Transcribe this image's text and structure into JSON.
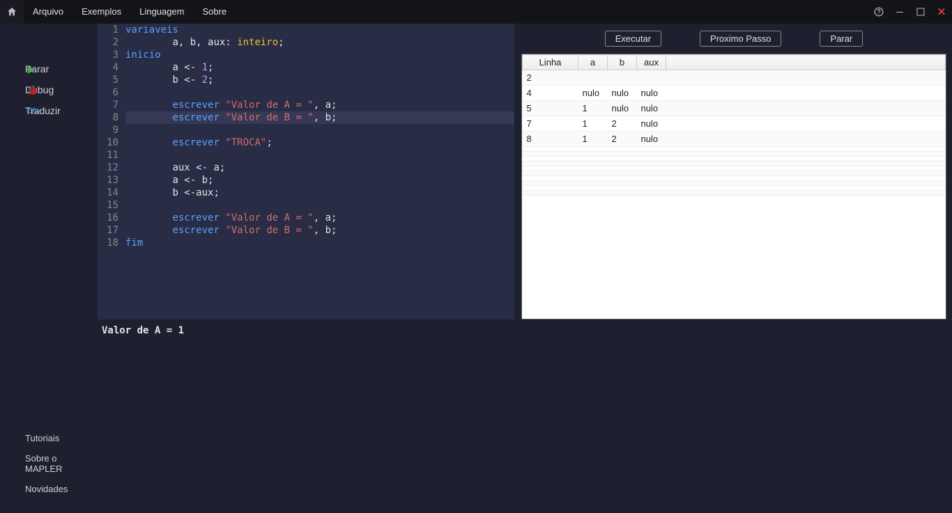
{
  "menu": {
    "items": [
      "Arquivo",
      "Exemplos",
      "Linguagem",
      "Sobre"
    ]
  },
  "sidebar": {
    "items": [
      {
        "icon": "play-icon",
        "label": "Parar"
      },
      {
        "icon": "bug-icon",
        "label": "Debug"
      },
      {
        "icon": "code-icon",
        "label": "Traduzir"
      }
    ],
    "bottom": [
      "Tutoriais",
      "Sobre o MAPLER",
      "Novidades"
    ]
  },
  "editor": {
    "highlight_line": 8,
    "lines": [
      {
        "n": 1,
        "tokens": [
          {
            "t": "variaveis",
            "c": "kw"
          }
        ]
      },
      {
        "n": 2,
        "tokens": [
          {
            "t": "        ",
            "c": ""
          },
          {
            "t": "a, b, aux",
            "c": "ident"
          },
          {
            "t": ": ",
            "c": "punct"
          },
          {
            "t": "inteiro",
            "c": "type"
          },
          {
            "t": ";",
            "c": "punct"
          }
        ]
      },
      {
        "n": 3,
        "tokens": [
          {
            "t": "inicio",
            "c": "kw"
          }
        ]
      },
      {
        "n": 4,
        "tokens": [
          {
            "t": "        ",
            "c": ""
          },
          {
            "t": "a ",
            "c": "ident"
          },
          {
            "t": "<- ",
            "c": "punct"
          },
          {
            "t": "1",
            "c": "num"
          },
          {
            "t": ";",
            "c": "punct"
          }
        ]
      },
      {
        "n": 5,
        "tokens": [
          {
            "t": "        ",
            "c": ""
          },
          {
            "t": "b ",
            "c": "ident"
          },
          {
            "t": "<- ",
            "c": "punct"
          },
          {
            "t": "2",
            "c": "num"
          },
          {
            "t": ";",
            "c": "punct"
          }
        ]
      },
      {
        "n": 6,
        "tokens": []
      },
      {
        "n": 7,
        "tokens": [
          {
            "t": "        ",
            "c": ""
          },
          {
            "t": "escrever",
            "c": "kw"
          },
          {
            "t": " ",
            "c": ""
          },
          {
            "t": "\"Valor de A = \"",
            "c": "str"
          },
          {
            "t": ", a;",
            "c": "ident"
          }
        ]
      },
      {
        "n": 8,
        "tokens": [
          {
            "t": "        ",
            "c": ""
          },
          {
            "t": "escrever",
            "c": "kw"
          },
          {
            "t": " ",
            "c": ""
          },
          {
            "t": "\"Valor de B = \"",
            "c": "str"
          },
          {
            "t": ", b;",
            "c": "ident"
          }
        ]
      },
      {
        "n": 9,
        "tokens": []
      },
      {
        "n": 10,
        "tokens": [
          {
            "t": "        ",
            "c": ""
          },
          {
            "t": "escrever",
            "c": "kw"
          },
          {
            "t": " ",
            "c": ""
          },
          {
            "t": "\"TROCA\"",
            "c": "str"
          },
          {
            "t": ";",
            "c": "punct"
          }
        ]
      },
      {
        "n": 11,
        "tokens": []
      },
      {
        "n": 12,
        "tokens": [
          {
            "t": "        ",
            "c": ""
          },
          {
            "t": "aux ",
            "c": "ident"
          },
          {
            "t": "<- ",
            "c": "punct"
          },
          {
            "t": "a;",
            "c": "ident"
          }
        ]
      },
      {
        "n": 13,
        "tokens": [
          {
            "t": "        ",
            "c": ""
          },
          {
            "t": "a ",
            "c": "ident"
          },
          {
            "t": "<- ",
            "c": "punct"
          },
          {
            "t": "b;",
            "c": "ident"
          }
        ]
      },
      {
        "n": 14,
        "tokens": [
          {
            "t": "        ",
            "c": ""
          },
          {
            "t": "b ",
            "c": "ident"
          },
          {
            "t": "<-",
            "c": "punct"
          },
          {
            "t": "aux;",
            "c": "ident"
          }
        ]
      },
      {
        "n": 15,
        "tokens": []
      },
      {
        "n": 16,
        "tokens": [
          {
            "t": "        ",
            "c": ""
          },
          {
            "t": "escrever",
            "c": "kw"
          },
          {
            "t": " ",
            "c": ""
          },
          {
            "t": "\"Valor de A = \"",
            "c": "str"
          },
          {
            "t": ", a;",
            "c": "ident"
          }
        ]
      },
      {
        "n": 17,
        "tokens": [
          {
            "t": "        ",
            "c": ""
          },
          {
            "t": "escrever",
            "c": "kw"
          },
          {
            "t": " ",
            "c": ""
          },
          {
            "t": "\"Valor de B = \"",
            "c": "str"
          },
          {
            "t": ", b;",
            "c": "ident"
          }
        ]
      },
      {
        "n": 18,
        "tokens": [
          {
            "t": "fim",
            "c": "kw"
          }
        ]
      }
    ]
  },
  "debug": {
    "buttons": {
      "executar": "Executar",
      "proximo": "Proximo Passo",
      "parar": "Parar"
    },
    "headers": [
      "Linha",
      "a",
      "b",
      "aux"
    ],
    "rows": [
      [
        "2",
        "",
        "",
        ""
      ],
      [
        "4",
        "nulo",
        "nulo",
        "nulo"
      ],
      [
        "5",
        "1",
        "nulo",
        "nulo"
      ],
      [
        "7",
        "1",
        "2",
        "nulo"
      ],
      [
        "8",
        "1",
        "2",
        "nulo"
      ]
    ]
  },
  "console": {
    "output": "Valor de A = 1"
  }
}
